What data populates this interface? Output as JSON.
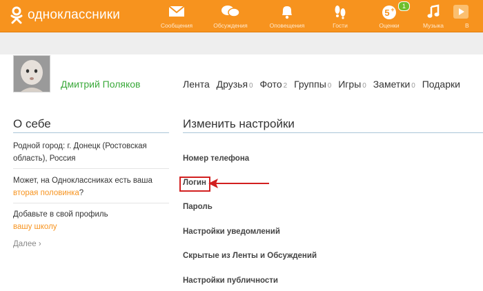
{
  "brand": {
    "name": "одноклассники"
  },
  "nav": [
    {
      "label": "Сообщения",
      "icon": "envelope-icon"
    },
    {
      "label": "Обсуждения",
      "icon": "speech-bubbles-icon"
    },
    {
      "label": "Оповещения",
      "icon": "bell-icon"
    },
    {
      "label": "Гости",
      "icon": "footprints-icon"
    },
    {
      "label": "Оценки",
      "icon": "five-plus-icon",
      "badge": "1"
    },
    {
      "label": "Музыка",
      "icon": "music-note-icon"
    },
    {
      "label": "В",
      "icon": "video-play-icon"
    }
  ],
  "profile": {
    "name": "Дмитрий Поляков",
    "menu": [
      {
        "label": "Лента",
        "count": ""
      },
      {
        "label": "Друзья",
        "count": "0"
      },
      {
        "label": "Фото",
        "count": "2"
      },
      {
        "label": "Группы",
        "count": "0"
      },
      {
        "label": "Игры",
        "count": "0"
      },
      {
        "label": "Заметки",
        "count": "0"
      },
      {
        "label": "Подарки",
        "count": ""
      }
    ]
  },
  "about": {
    "title": "О себе",
    "hometown": "Родной город: г. Донецк (Ростовская область), Россия",
    "spouse_prefix": "Может, на Одноклассниках есть ваша ",
    "spouse_link": "вторая половинка",
    "spouse_suffix": "?",
    "school_prefix": "Добавьте в свой профиль",
    "school_link": "вашу школу",
    "more": "Далее ›"
  },
  "settings": {
    "title": "Изменить настройки",
    "items": [
      "Номер телефона",
      "Логин",
      "Пароль",
      "Настройки уведомлений",
      "Скрытые из Ленты и Обсуждений",
      "Настройки публичности"
    ]
  },
  "colors": {
    "brand": "#f7931e",
    "accent_green": "#3aa93a",
    "highlight": "#d21f1f"
  }
}
